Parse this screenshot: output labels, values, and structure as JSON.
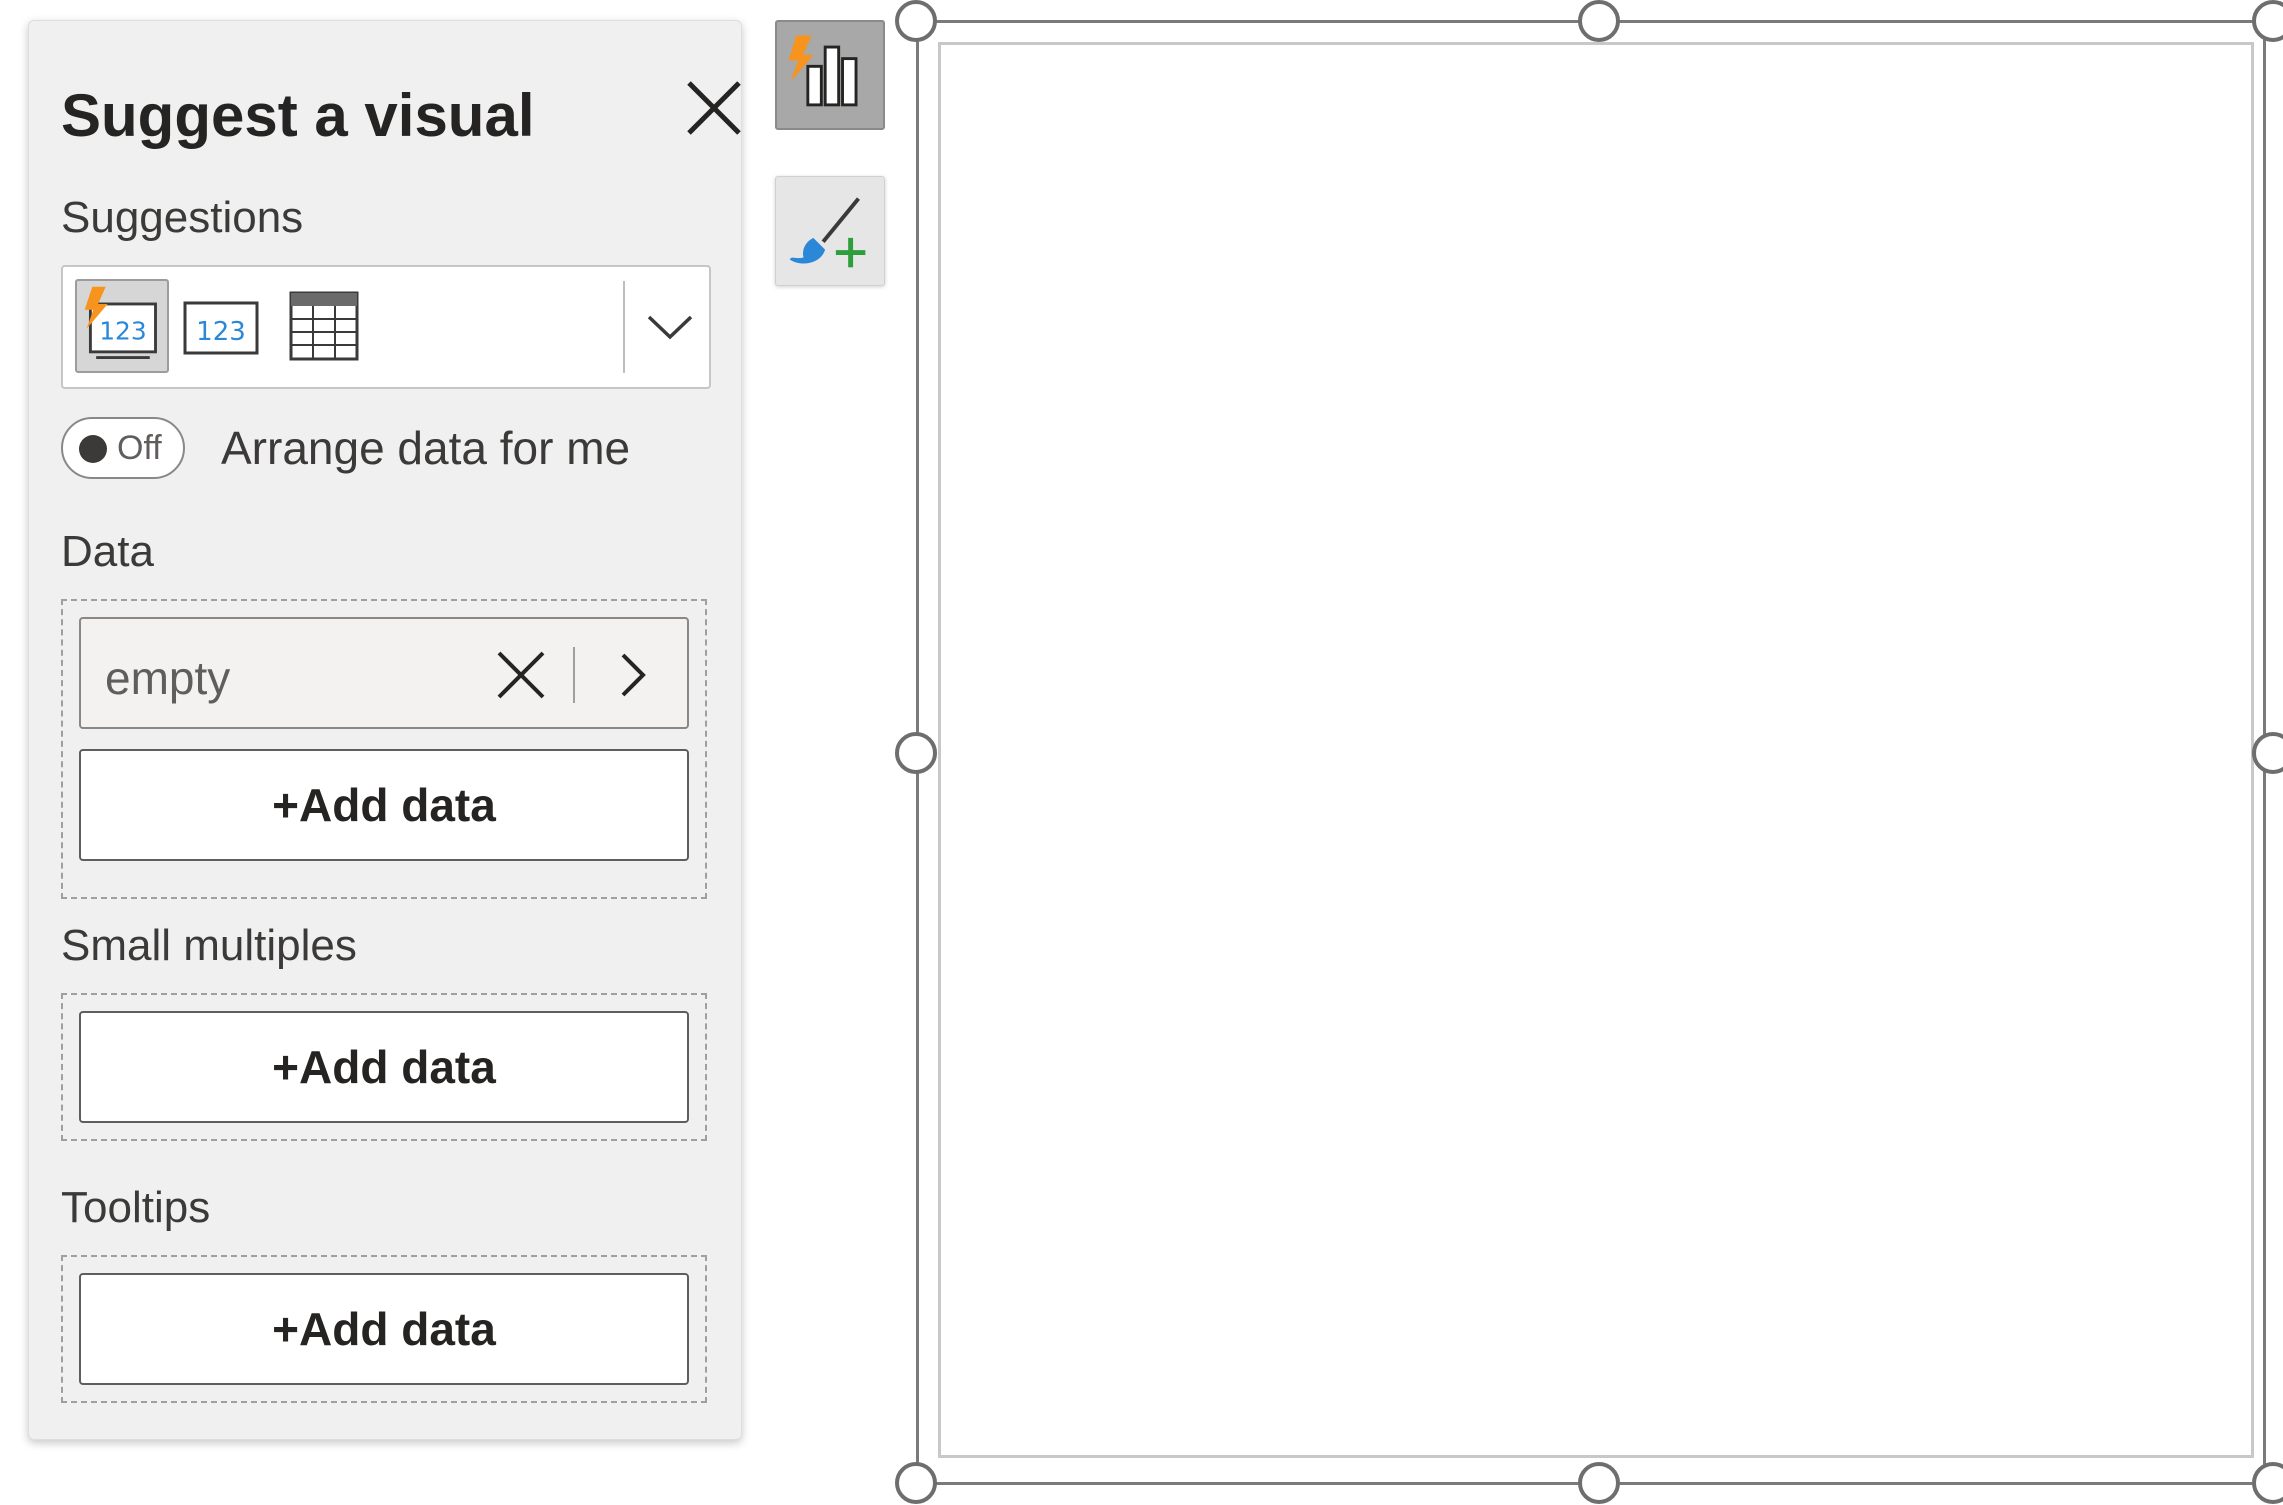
{
  "panel": {
    "title": "Suggest a visual",
    "suggestions_label": "Suggestions",
    "suggestion_icons": [
      "quick-insights-card-icon",
      "card-icon",
      "table-icon"
    ],
    "toggle_state": "Off",
    "toggle_label": "Arrange data for me",
    "data": {
      "label": "Data",
      "field": "empty",
      "add_label": "+Add data"
    },
    "small_multiples": {
      "label": "Small multiples",
      "add_label": "+Add data"
    },
    "tooltips": {
      "label": "Tooltips",
      "add_label": "+Add data"
    }
  },
  "colors": {
    "accent_orange": "#f7941d",
    "blue": "#2b88d8",
    "green": "#2e9e3d"
  }
}
